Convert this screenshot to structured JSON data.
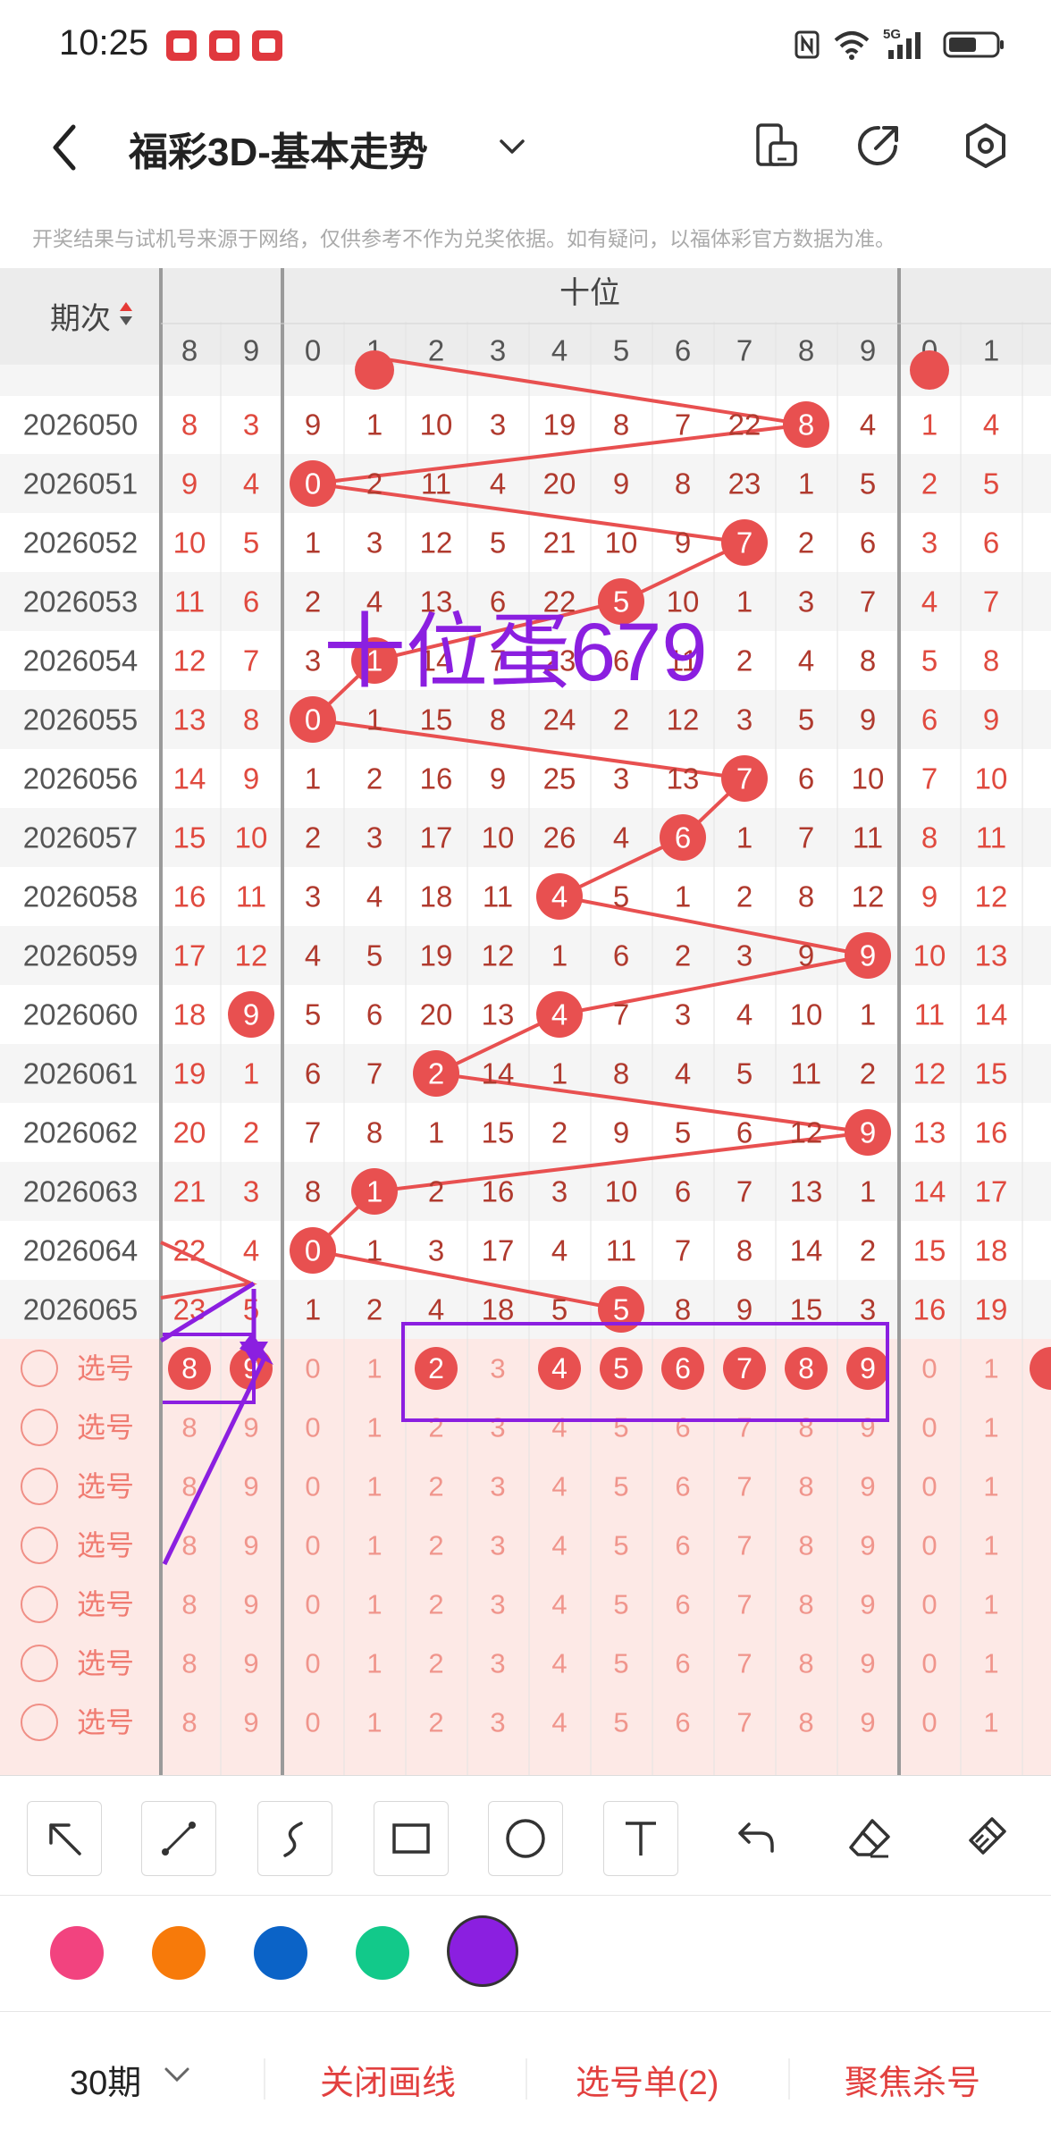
{
  "status_bar": {
    "time": "10:25",
    "network": "5G"
  },
  "header": {
    "title": "福彩3D-基本走势"
  },
  "notice": "开奖结果与试机号来源于网络，仅供参考不作为兑奖依据。如有疑问，以福体彩官方数据为准。",
  "table": {
    "period_header": "期次",
    "group_label": "十位",
    "left_cols": [
      "8",
      "9"
    ],
    "tens_cols": [
      "0",
      "1",
      "2",
      "3",
      "4",
      "5",
      "6",
      "7",
      "8",
      "9"
    ],
    "right_cols": [
      "0",
      "1"
    ],
    "rows": [
      {
        "period": "2026050",
        "left": [
          "8",
          "3"
        ],
        "tens": [
          "9",
          "1",
          "10",
          "3",
          "19",
          "8",
          "7",
          "22",
          "8",
          "4"
        ],
        "right": [
          "1",
          "4"
        ]
      },
      {
        "period": "2026051",
        "left": [
          "9",
          "4"
        ],
        "tens": [
          "0",
          "2",
          "11",
          "4",
          "20",
          "9",
          "8",
          "23",
          "1",
          "5"
        ],
        "right": [
          "2",
          "5"
        ]
      },
      {
        "period": "2026052",
        "left": [
          "10",
          "5"
        ],
        "tens": [
          "1",
          "3",
          "12",
          "5",
          "21",
          "10",
          "9",
          "7",
          "2",
          "6"
        ],
        "right": [
          "3",
          "6"
        ]
      },
      {
        "period": "2026053",
        "left": [
          "11",
          "6"
        ],
        "tens": [
          "2",
          "4",
          "13",
          "6",
          "22",
          "5",
          "10",
          "1",
          "3",
          "7"
        ],
        "right": [
          "4",
          "7"
        ]
      },
      {
        "period": "2026054",
        "left": [
          "12",
          "7"
        ],
        "tens": [
          "3",
          "1",
          "14",
          "7",
          "23",
          "6",
          "11",
          "2",
          "4",
          "8"
        ],
        "right": [
          "5",
          "8"
        ]
      },
      {
        "period": "2026055",
        "left": [
          "13",
          "8"
        ],
        "tens": [
          "0",
          "1",
          "15",
          "8",
          "24",
          "2",
          "12",
          "3",
          "5",
          "9"
        ],
        "right": [
          "6",
          "9"
        ]
      },
      {
        "period": "2026056",
        "left": [
          "14",
          "9"
        ],
        "tens": [
          "1",
          "2",
          "16",
          "9",
          "25",
          "3",
          "13",
          "7",
          "6",
          "10"
        ],
        "right": [
          "7",
          "10"
        ]
      },
      {
        "period": "2026057",
        "left": [
          "15",
          "10"
        ],
        "tens": [
          "2",
          "3",
          "17",
          "10",
          "26",
          "4",
          "6",
          "1",
          "7",
          "11"
        ],
        "right": [
          "8",
          "11"
        ]
      },
      {
        "period": "2026058",
        "left": [
          "16",
          "11"
        ],
        "tens": [
          "3",
          "4",
          "18",
          "11",
          "4",
          "5",
          "1",
          "2",
          "8",
          "12"
        ],
        "right": [
          "9",
          "12"
        ]
      },
      {
        "period": "2026059",
        "left": [
          "17",
          "12"
        ],
        "tens": [
          "4",
          "5",
          "19",
          "12",
          "1",
          "6",
          "2",
          "3",
          "9",
          "9"
        ],
        "right": [
          "10",
          "13"
        ]
      },
      {
        "period": "2026060",
        "left": [
          "18",
          "9"
        ],
        "tens": [
          "5",
          "6",
          "20",
          "13",
          "4",
          "7",
          "3",
          "4",
          "10",
          "1"
        ],
        "right": [
          "11",
          "14"
        ]
      },
      {
        "period": "2026061",
        "left": [
          "19",
          "1"
        ],
        "tens": [
          "6",
          "7",
          "2",
          "14",
          "1",
          "8",
          "4",
          "5",
          "11",
          "2"
        ],
        "right": [
          "12",
          "15"
        ]
      },
      {
        "period": "2026062",
        "left": [
          "20",
          "2"
        ],
        "tens": [
          "7",
          "8",
          "1",
          "15",
          "2",
          "9",
          "5",
          "6",
          "12",
          "9"
        ],
        "right": [
          "13",
          "16"
        ]
      },
      {
        "period": "2026063",
        "left": [
          "21",
          "3"
        ],
        "tens": [
          "8",
          "1",
          "2",
          "16",
          "3",
          "10",
          "6",
          "7",
          "13",
          "1"
        ],
        "right": [
          "14",
          "17"
        ]
      },
      {
        "period": "2026064",
        "left": [
          "22",
          "4"
        ],
        "tens": [
          "0",
          "1",
          "3",
          "17",
          "4",
          "11",
          "7",
          "8",
          "14",
          "2"
        ],
        "right": [
          "15",
          "18"
        ]
      },
      {
        "period": "2026065",
        "left": [
          "23",
          "5"
        ],
        "tens": [
          "1",
          "2",
          "4",
          "18",
          "5",
          "5",
          "8",
          "9",
          "15",
          "3"
        ],
        "right": [
          "16",
          "19"
        ]
      }
    ],
    "tens_hits": [
      8,
      0,
      7,
      5,
      1,
      0,
      7,
      6,
      4,
      9,
      4,
      2,
      9,
      1,
      0,
      5
    ],
    "left_hits": [
      null,
      null,
      null,
      null,
      null,
      null,
      null,
      null,
      null,
      null,
      1,
      null,
      null,
      null,
      null,
      null
    ],
    "select_label": "选号",
    "select_rows": 7,
    "selected_tens": [
      2,
      4,
      5,
      6,
      7,
      8,
      9
    ],
    "selected_left": [
      0,
      1
    ]
  },
  "annotation": {
    "text": "十位蛋679",
    "color": "#8b1fe0"
  },
  "trend_color": "#e85050",
  "toolbar": {
    "tools": [
      "arrow-tool",
      "line-tool",
      "freehand-tool",
      "rectangle-tool",
      "circle-tool",
      "text-tool",
      "undo-tool",
      "eraser-tool",
      "clear-tool"
    ]
  },
  "colors": [
    "#f2437f",
    "#f77a0a",
    "#0b63c7",
    "#12c98a",
    "#8b1fe0"
  ],
  "bottom_bar": {
    "period_select": "30期",
    "close_drawing": "关闭画线",
    "selection_list": "选号单(2)",
    "focus_kill": "聚焦杀号"
  }
}
